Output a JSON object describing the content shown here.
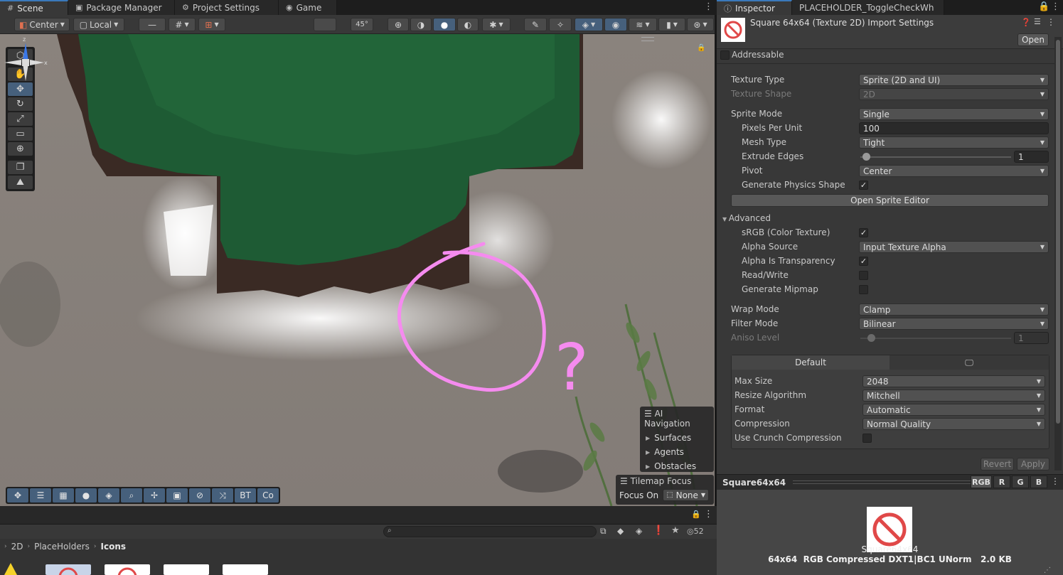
{
  "tabs_left": [
    {
      "label": "Scene",
      "icon": "hash-icon"
    },
    {
      "label": "Package Manager",
      "icon": "package-icon"
    },
    {
      "label": "Project Settings",
      "icon": "gear-icon"
    },
    {
      "label": "Game",
      "icon": "gamepad-icon"
    }
  ],
  "tabs_right": [
    {
      "label": "Inspector",
      "icon": "info-icon"
    },
    {
      "label": "PLACEHOLDER_ToggleCheckWh"
    }
  ],
  "scene_toolbar": {
    "pivot": "Center",
    "space": "Local",
    "snap_value": "—",
    "angle": "45°",
    "bt": "BT",
    "co": "Co"
  },
  "ai_navigation": {
    "title": "AI Navigation",
    "items": [
      "Surfaces",
      "Agents",
      "Obstacles"
    ]
  },
  "tilemap_focus": {
    "title": "Tilemap Focus",
    "label": "Focus On",
    "value": "None"
  },
  "annotation": {
    "mark": "?"
  },
  "project": {
    "count": "52",
    "breadcrumb": [
      "2D",
      "PlaceHolders",
      "Icons"
    ]
  },
  "inspector": {
    "title": "Square 64x64 (Texture 2D) Import Settings",
    "open_button": "Open",
    "addressable": "Addressable",
    "fields": {
      "texture_type": {
        "label": "Texture Type",
        "value": "Sprite (2D and UI)"
      },
      "texture_shape": {
        "label": "Texture Shape",
        "value": "2D"
      },
      "sprite_mode": {
        "label": "Sprite Mode",
        "value": "Single"
      },
      "pixels_per_unit": {
        "label": "Pixels Per Unit",
        "value": "100"
      },
      "mesh_type": {
        "label": "Mesh Type",
        "value": "Tight"
      },
      "extrude_edges": {
        "label": "Extrude Edges",
        "value": "1"
      },
      "pivot": {
        "label": "Pivot",
        "value": "Center"
      },
      "generate_physics_shape": {
        "label": "Generate Physics Shape",
        "checked": true
      },
      "open_sprite_editor": "Open Sprite Editor",
      "advanced": "Advanced",
      "srgb": {
        "label": "sRGB (Color Texture)",
        "checked": true
      },
      "alpha_source": {
        "label": "Alpha Source",
        "value": "Input Texture Alpha"
      },
      "alpha_is_transparency": {
        "label": "Alpha Is Transparency",
        "checked": true
      },
      "read_write": {
        "label": "Read/Write",
        "checked": false
      },
      "generate_mipmap": {
        "label": "Generate Mipmap",
        "checked": false
      },
      "wrap_mode": {
        "label": "Wrap Mode",
        "value": "Clamp"
      },
      "filter_mode": {
        "label": "Filter Mode",
        "value": "Bilinear"
      },
      "aniso_level": {
        "label": "Aniso Level",
        "value": "1"
      }
    },
    "platform": {
      "default_tab": "Default",
      "max_size": {
        "label": "Max Size",
        "value": "2048"
      },
      "resize_algorithm": {
        "label": "Resize Algorithm",
        "value": "Mitchell"
      },
      "format": {
        "label": "Format",
        "value": "Automatic"
      },
      "compression": {
        "label": "Compression",
        "value": "Normal Quality"
      },
      "crunch": {
        "label": "Use Crunch Compression",
        "checked": false
      }
    },
    "revert": "Revert",
    "apply": "Apply",
    "preview": {
      "name": "Square64x64",
      "channels": [
        "RGB",
        "R",
        "G",
        "B"
      ],
      "caption_name": "Square64x64",
      "caption_info": "64x64  RGB Compressed DXT1|BC1 UNorm   2.0 KB"
    }
  },
  "colors": {
    "accent": "#46607c",
    "annotation": "#f58bef",
    "grass_dark": "#1e5b34",
    "rock_dark": "#3a2a24"
  }
}
